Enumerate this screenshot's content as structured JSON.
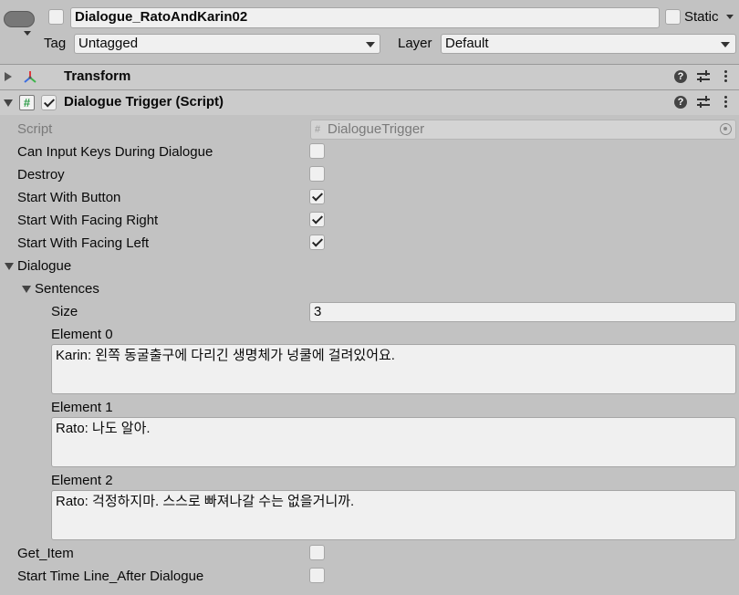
{
  "header": {
    "object_name": "Dialogue_RatoAndKarin02",
    "static_label": "Static",
    "tag_label": "Tag",
    "tag_value": "Untagged",
    "layer_label": "Layer",
    "layer_value": "Default"
  },
  "transform": {
    "title": "Transform"
  },
  "dialogue_trigger": {
    "title": "Dialogue Trigger (Script)",
    "script_label": "Script",
    "script_value": "DialogueTrigger",
    "fields": [
      {
        "label": "Can Input Keys During Dialogue",
        "checked": false
      },
      {
        "label": "Destroy",
        "checked": false
      },
      {
        "label": "Start With Button",
        "checked": true
      },
      {
        "label": "Start With Facing Right",
        "checked": true
      },
      {
        "label": "Start With Facing Left",
        "checked": true
      }
    ],
    "dialogue_label": "Dialogue",
    "sentences_label": "Sentences",
    "size_label": "Size",
    "size_value": "3",
    "elements": [
      {
        "label": "Element 0",
        "value": "Karin: 왼쪽 동굴출구에 다리긴 생명체가 넝쿨에 걸려있어요."
      },
      {
        "label": "Element 1",
        "value": "Rato: 나도 알아."
      },
      {
        "label": "Element 2",
        "value": "Rato: 걱정하지마. 스스로 빠져나갈 수는 없을거니까."
      }
    ],
    "bottom_fields": [
      {
        "label": "Get_Item",
        "checked": false
      },
      {
        "label": "Start Time Line_After Dialogue",
        "checked": false
      }
    ]
  },
  "colors": {
    "background": "#c2c2c2",
    "field": "#f0f0f0",
    "script_icon": "#2e9c48",
    "transform_red": "#e0383c",
    "transform_green": "#3cb44a",
    "transform_blue": "#3c6ee0"
  },
  "icons": [
    "gameobject-icon",
    "transform-icon",
    "script-icon",
    "help-icon",
    "preset-icon",
    "kebab-menu-icon",
    "object-picker-icon"
  ]
}
